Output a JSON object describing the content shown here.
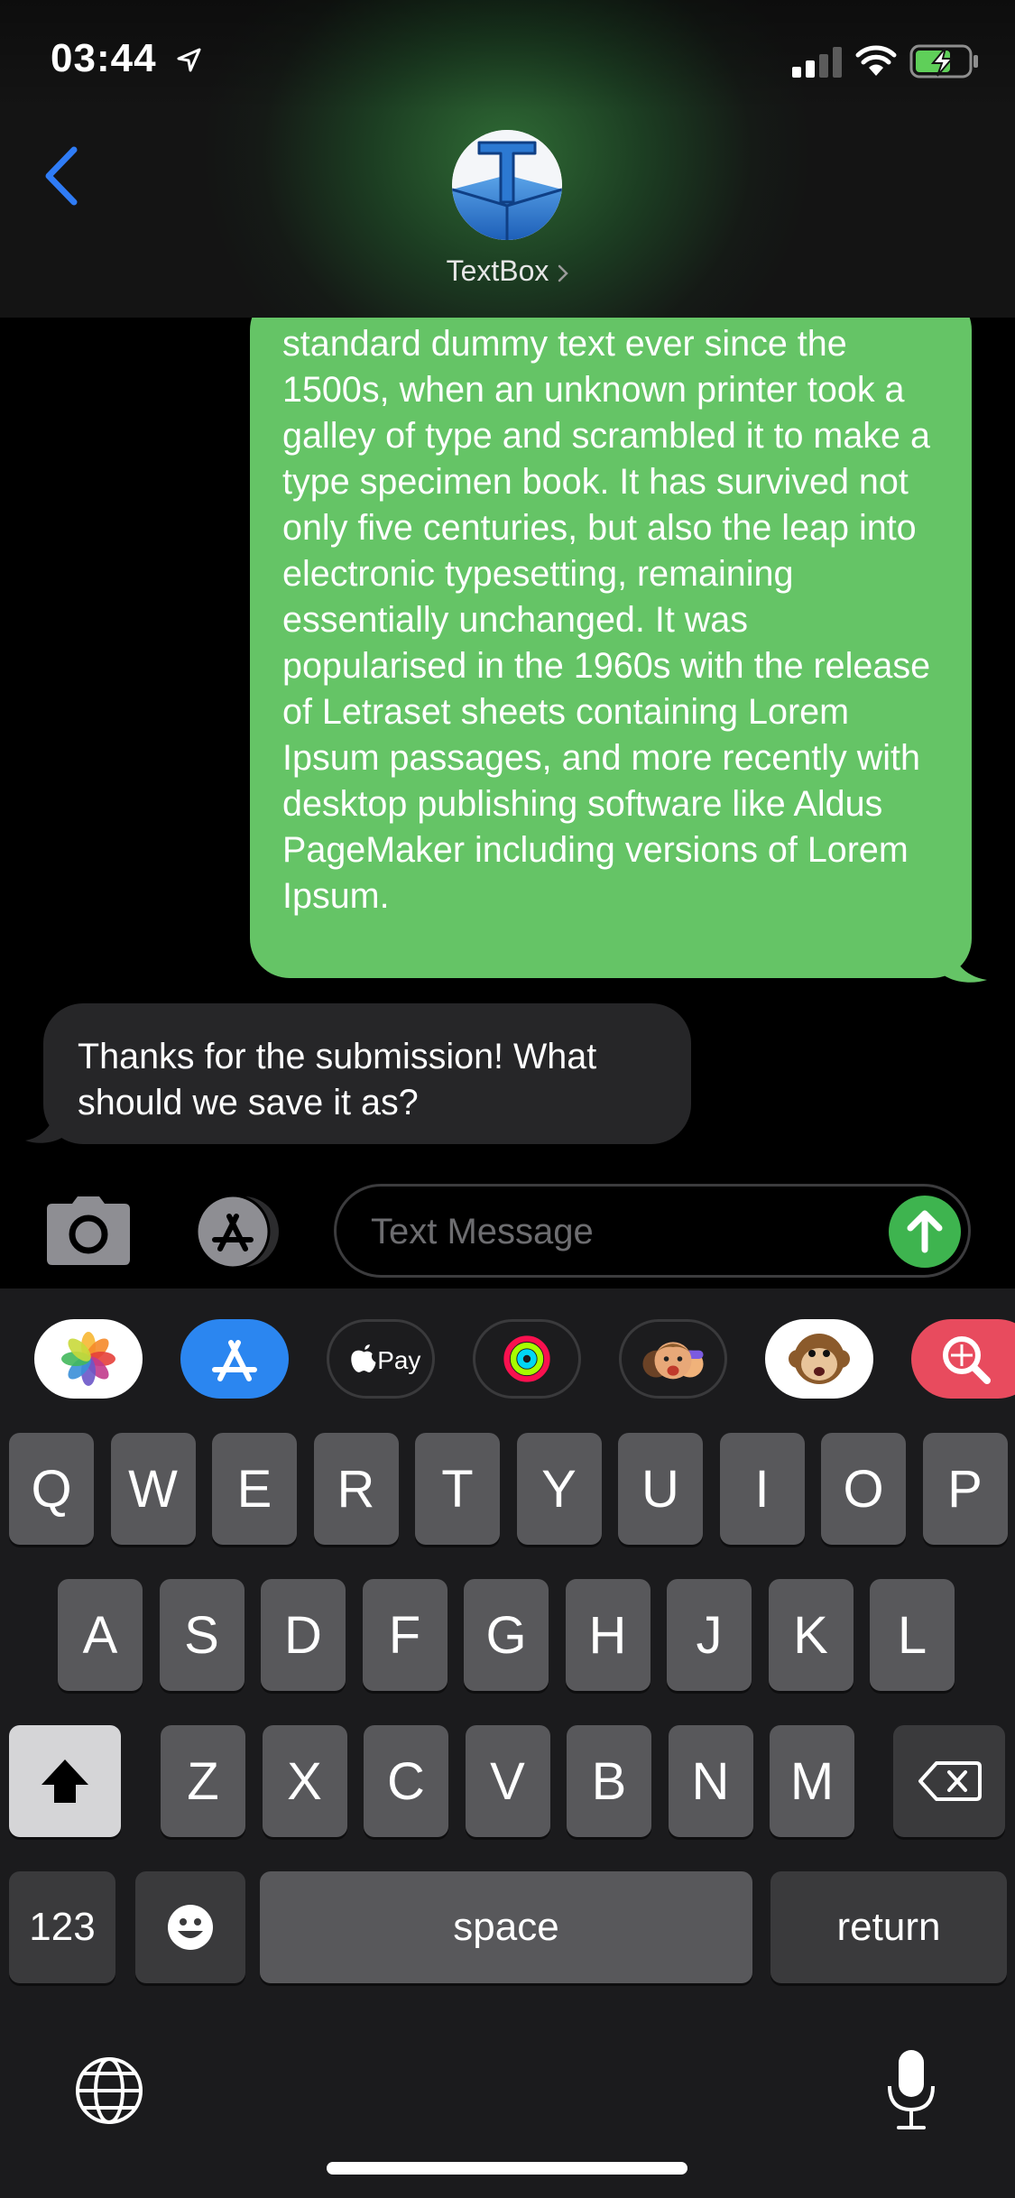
{
  "status_bar": {
    "time": "03:44"
  },
  "header": {
    "contact_name": "TextBox"
  },
  "conversation": {
    "outgoing": "standard dummy text ever since the 1500s, when an unknown printer took a galley of type and scrambled it to make a type specimen book. It has survived not only five centuries, but also the leap into electronic typesetting, remaining essentially unchanged. It was popularised in the 1960s with the release of Letraset sheets containing Lorem Ipsum passages, and more recently with desktop publishing software like Aldus PageMaker including versions of Lorem Ipsum.",
    "incoming": "Thanks for the submission! What should we save it as?"
  },
  "compose": {
    "placeholder": "Text Message"
  },
  "app_strip": [
    {
      "name": "photos-app"
    },
    {
      "name": "app-store-app"
    },
    {
      "name": "apple-pay-app",
      "label": "Pay"
    },
    {
      "name": "activity-app"
    },
    {
      "name": "memoji-app"
    },
    {
      "name": "animoji-app"
    },
    {
      "name": "images-search-app"
    }
  ],
  "keyboard": {
    "row1": [
      "Q",
      "W",
      "E",
      "R",
      "T",
      "Y",
      "U",
      "I",
      "O",
      "P"
    ],
    "row2": [
      "A",
      "S",
      "D",
      "F",
      "G",
      "H",
      "J",
      "K",
      "L"
    ],
    "row3": [
      "Z",
      "X",
      "C",
      "V",
      "B",
      "N",
      "M"
    ],
    "numbers_label": "123",
    "space_label": "space",
    "return_label": "return"
  },
  "colors": {
    "outgoing_bubble": "#65c466",
    "incoming_bubble": "#262628",
    "send_button": "#3eb44f",
    "ios_blue": "#2f7cf6"
  }
}
